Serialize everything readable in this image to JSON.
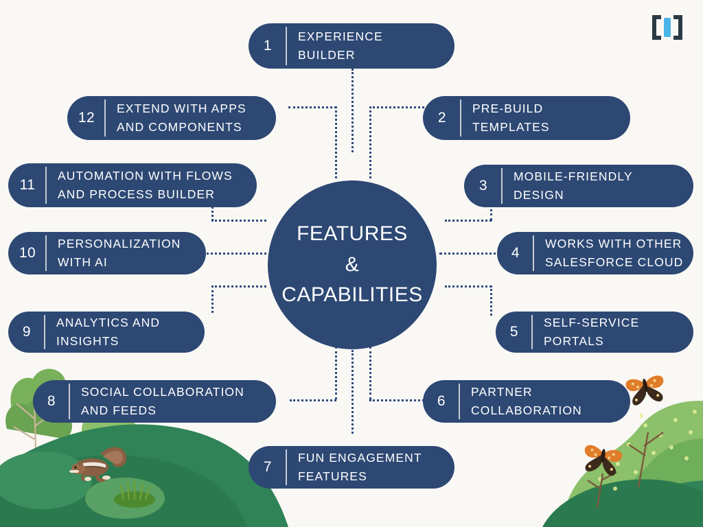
{
  "theme": {
    "background": "#faf8f5",
    "pill_fill": "#2d4873",
    "pill_text": "#ffffff",
    "connector": "#2e4a7d",
    "logo_bracket": "#2b3a44",
    "logo_letter": "#4cb4e7",
    "hill_dark_green": "#2f8356",
    "hill_light_green": "#8cc06a",
    "butterfly_orange": "#e07c2a"
  },
  "logo": {
    "name": "bracket-i-logo",
    "left_bracket": "[",
    "letter": "i",
    "right_bracket": "]"
  },
  "hub": {
    "lines": [
      "FEATURES",
      "&",
      "CAPABILITIES"
    ]
  },
  "nodes": [
    {
      "id": 1,
      "number": "1",
      "lines": [
        "EXPERIENCE",
        "BUILDER"
      ],
      "num_side": "left"
    },
    {
      "id": 2,
      "number": "2",
      "lines": [
        "PRE-BUILD",
        "TEMPLATES"
      ],
      "num_side": "left"
    },
    {
      "id": 3,
      "number": "3",
      "lines": [
        "MOBILE-FRIENDLY",
        "DESIGN"
      ],
      "num_side": "left"
    },
    {
      "id": 4,
      "number": "4",
      "lines": [
        "WORKS WITH OTHER",
        "SALESFORCE CLOUD"
      ],
      "num_side": "left"
    },
    {
      "id": 5,
      "number": "5",
      "lines": [
        "SELF-SERVICE",
        "PORTALS"
      ],
      "num_side": "left"
    },
    {
      "id": 6,
      "number": "6",
      "lines": [
        "PARTNER",
        "COLLABORATION"
      ],
      "num_side": "left"
    },
    {
      "id": 7,
      "number": "7",
      "lines": [
        "FUN ENGAGEMENT",
        "FEATURES"
      ],
      "num_side": "left"
    },
    {
      "id": 8,
      "number": "8",
      "lines": [
        "SOCIAL COLLABORATION",
        "AND FEEDS"
      ],
      "num_side": "left"
    },
    {
      "id": 9,
      "number": "9",
      "lines": [
        "ANALYTICS AND",
        "INSIGHTS"
      ],
      "num_side": "left"
    },
    {
      "id": 10,
      "number": "10",
      "lines": [
        "PERSONALIZATION",
        "WITH AI"
      ],
      "num_side": "left"
    },
    {
      "id": 11,
      "number": "11",
      "lines": [
        "AUTOMATION WITH FLOWS",
        "AND PROCESS BUILDER"
      ],
      "num_side": "left"
    },
    {
      "id": 12,
      "number": "12",
      "lines": [
        "EXTEND WITH APPS",
        "AND COMPONENTS"
      ],
      "num_side": "left"
    }
  ]
}
